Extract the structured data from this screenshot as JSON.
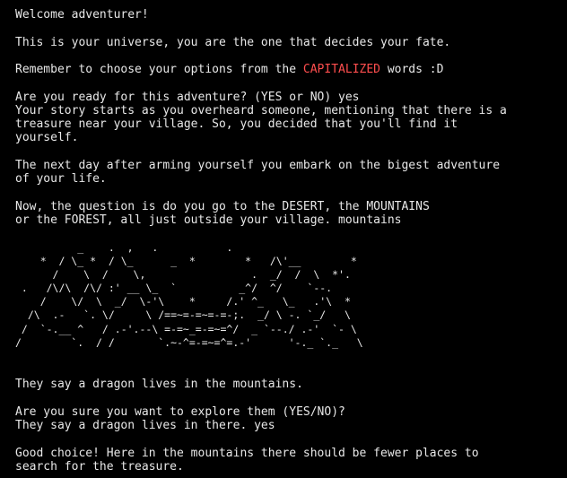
{
  "colors": {
    "background": "#000000",
    "text": "#e8e8e8",
    "highlight": "#ff4e4e"
  },
  "lines": {
    "welcome": "Welcome adventurer!",
    "universe": "This is your universe, you are the one that decides your fate.",
    "remember_before": "Remember to choose your options from the ",
    "remember_highlight": "CAPITALIZED",
    "remember_after": " words :D",
    "ready_prompt": "Are you ready for this adventure? (YES or NO) yes",
    "story_1": "Your story starts as you overheard someone, mentioning that there is a",
    "story_2": "treasure near your village. So, you decided that you'll find it",
    "story_3": "yourself.",
    "nextday_1": "The next day after arming yourself you embark on the bigest adventure",
    "nextday_2": "of your life.",
    "question_1": "Now, the question is do you go to the DESERT, the MOUNTAINS",
    "question_2": "or the FOREST, all just outside your village. mountains",
    "dragon_1": "They say a dragon lives in the mountains.",
    "sure_1": "Are you sure you want to explore them (YES/NO)?",
    "sure_2": "They say a dragon lives in there. yes",
    "good_1": "Good choice! Here in the mountains there should be fewer places to",
    "good_2": "search for the treasure."
  },
  "ascii_art": "          _    .  ,   .           .\n    *  / \\_ *  / \\_      _  *        *   /\\'__        *\n      /    \\  /    \\,                 .  _/  /  \\  *'.\n .   /\\/\\  /\\/ :' __ \\_  `          _^/  ^/    `--.\n    /    \\/  \\  _/  \\-'\\    *     /.' ^_   \\_   .'\\  *\n  /\\  .-   `. \\/     \\ /==~=-=~=-=-;.  _/ \\ -. `_/   \\\n /  `-.__ ^   / .-'.--\\ =-=~_=-=~=^/  _ `--./ .-'  `- \\\n/        `.  / /       `.~-^=-=~=^=.-'      '-._ `._   \\"
}
